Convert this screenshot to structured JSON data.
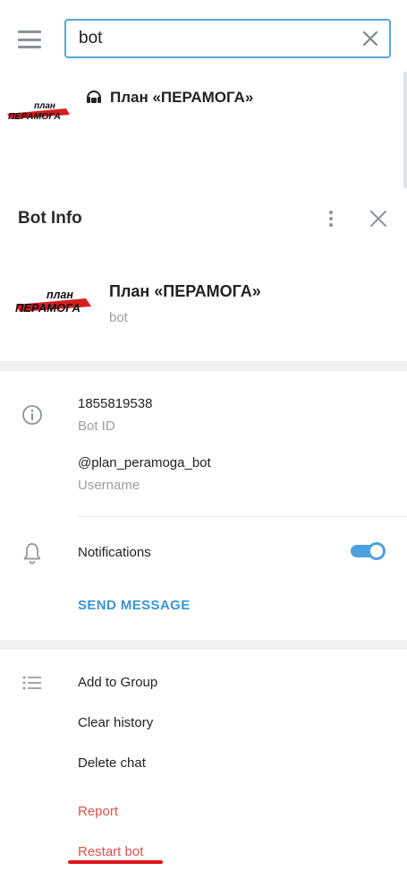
{
  "search": {
    "query": "bot",
    "result_title": "План «ПЕРАМОГА»"
  },
  "logo_text": {
    "line1": "план",
    "line2": "ПЕРАМОГА"
  },
  "panel": {
    "title": "Bot Info"
  },
  "profile": {
    "name": "План «ПЕРАМОГА»",
    "type": "bot"
  },
  "info": {
    "bot_id_value": "1855819538",
    "bot_id_label": "Bot ID",
    "username_value": "@plan_peramoga_bot",
    "username_label": "Username",
    "notifications_label": "Notifications",
    "notifications_on": true,
    "send_message": "SEND MESSAGE"
  },
  "actions": {
    "add_to_group": "Add to Group",
    "clear_history": "Clear history",
    "delete_chat": "Delete chat",
    "report": "Report",
    "restart_bot": "Restart bot"
  },
  "icons": {
    "menu": "hamburger-menu-icon",
    "clear": "close-icon",
    "bot": "bot-icon",
    "more": "more-vertical-icon",
    "close": "close-icon",
    "info": "info-icon",
    "notifications": "bell-icon",
    "actions": "list-icon"
  },
  "colors": {
    "accent": "#3a95d3",
    "danger": "#d9534f",
    "highlight_underline": "#e3151b",
    "logo_red": "#d81e1e"
  }
}
